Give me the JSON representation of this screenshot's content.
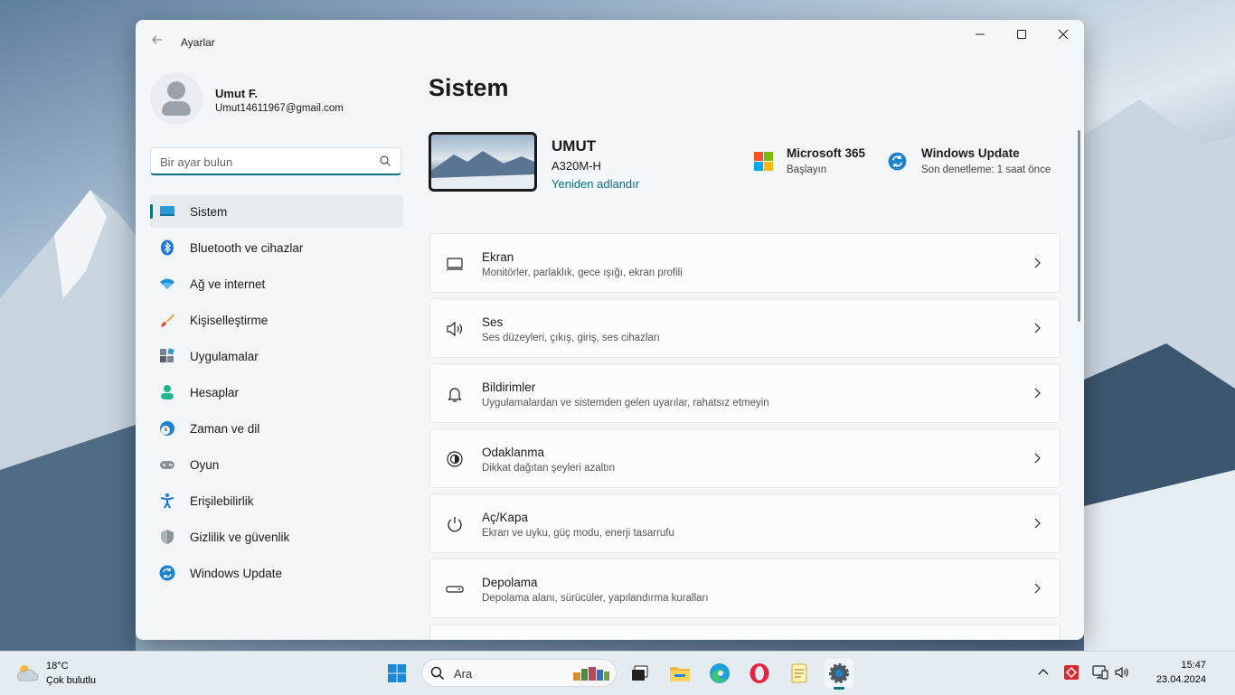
{
  "window": {
    "app_title": "Ayarlar",
    "back_icon": "arrow-left-icon",
    "controls": [
      "minimize-icon",
      "maximize-icon",
      "close-icon"
    ]
  },
  "profile": {
    "name": "Umut F.",
    "email": "Umut14611967@gmail.com"
  },
  "search": {
    "placeholder": "Bir ayar bulun",
    "value": ""
  },
  "sidebar": {
    "items": [
      {
        "label": "Sistem",
        "icon": "monitor-icon",
        "active": true
      },
      {
        "label": "Bluetooth ve cihazlar",
        "icon": "bluetooth-icon"
      },
      {
        "label": "Ağ ve internet",
        "icon": "wifi-icon"
      },
      {
        "label": "Kişiselleştirme",
        "icon": "brush-icon"
      },
      {
        "label": "Uygulamalar",
        "icon": "apps-icon"
      },
      {
        "label": "Hesaplar",
        "icon": "person-icon"
      },
      {
        "label": "Zaman ve dil",
        "icon": "globe-clock-icon"
      },
      {
        "label": "Oyun",
        "icon": "gamepad-icon"
      },
      {
        "label": "Erişilebilirlik",
        "icon": "accessibility-icon"
      },
      {
        "label": "Gizlilik ve güvenlik",
        "icon": "shield-icon"
      },
      {
        "label": "Windows Update",
        "icon": "sync-icon"
      }
    ]
  },
  "main": {
    "title": "Sistem",
    "device": {
      "name": "UMUT",
      "model": "A320M-H",
      "rename_link": "Yeniden adlandır"
    },
    "promos": [
      {
        "title": "Microsoft 365",
        "subtitle": "Başlayın",
        "icon": "microsoft-logo-icon"
      },
      {
        "title": "Windows Update",
        "subtitle": "Son denetleme: 1 saat önce",
        "icon": "sync-icon"
      }
    ],
    "cards": [
      {
        "title": "Ekran",
        "subtitle": "Monitörler, parlaklık, gece ışığı, ekran profili",
        "icon": "display-icon"
      },
      {
        "title": "Ses",
        "subtitle": "Ses düzeyleri, çıkış, giriş, ses cihazları",
        "icon": "speaker-icon"
      },
      {
        "title": "Bildirimler",
        "subtitle": "Uygulamalardan ve sistemden gelen uyarılar, rahatsız etmeyin",
        "icon": "bell-icon"
      },
      {
        "title": "Odaklanma",
        "subtitle": "Dikkat dağıtan şeyleri azaltın",
        "icon": "focus-icon"
      },
      {
        "title": "Aç/Kapa",
        "subtitle": "Ekran ve uyku, güç modu, enerji tasarrufu",
        "icon": "power-icon"
      },
      {
        "title": "Depolama",
        "subtitle": "Depolama alanı, sürücüler, yapılandırma kuralları",
        "icon": "storage-icon"
      }
    ]
  },
  "taskbar": {
    "weather": {
      "temp": "18°C",
      "condition": "Çok bulutlu",
      "icon": "cloud-sun-icon"
    },
    "search_label": "Ara",
    "apps": [
      "windows-start-icon",
      "task-view-icon",
      "file-explorer-icon",
      "edge-icon",
      "opera-icon",
      "notepad-icon",
      "settings-gear-icon"
    ],
    "tray": [
      "chevron-up-icon",
      "anydesk-icon",
      "network-icon",
      "volume-icon"
    ],
    "time": "15:47",
    "date": "23.04.2024"
  },
  "colors": {
    "accent": "#0f6c81",
    "window_bg": "#f3f6f9",
    "card_bg": "#fbfcfd"
  }
}
